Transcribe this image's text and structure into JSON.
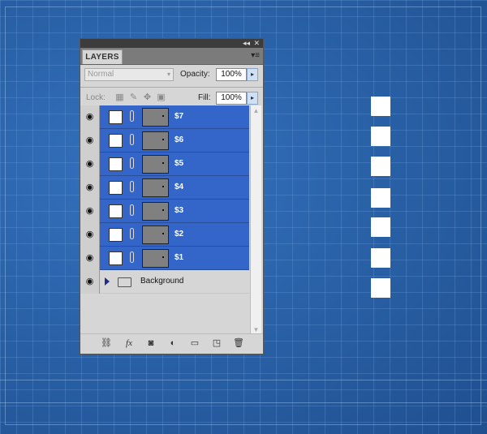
{
  "panel": {
    "tab_label": "LAYERS",
    "blend_mode": "Normal",
    "opacity_label": "Opacity:",
    "opacity_value": "100%",
    "lock_label": "Lock:",
    "fill_label": "Fill:",
    "fill_value": "100%"
  },
  "layers": [
    {
      "name": "$7",
      "selected": true
    },
    {
      "name": "$6",
      "selected": true
    },
    {
      "name": "$5",
      "selected": true
    },
    {
      "name": "$4",
      "selected": true
    },
    {
      "name": "$3",
      "selected": true
    },
    {
      "name": "$2",
      "selected": true
    },
    {
      "name": "$1",
      "selected": true
    },
    {
      "name": "Background",
      "type": "group",
      "selected": false
    }
  ],
  "footer_icons": [
    "link-icon",
    "fx-icon",
    "mask-icon",
    "adjustment-icon",
    "folder-icon",
    "new-layer-icon",
    "trash-icon"
  ],
  "colors": {
    "canvas_blue": "#2a62a8",
    "selection_blue": "#3465c8",
    "panel_gray": "#d6d6d6"
  }
}
